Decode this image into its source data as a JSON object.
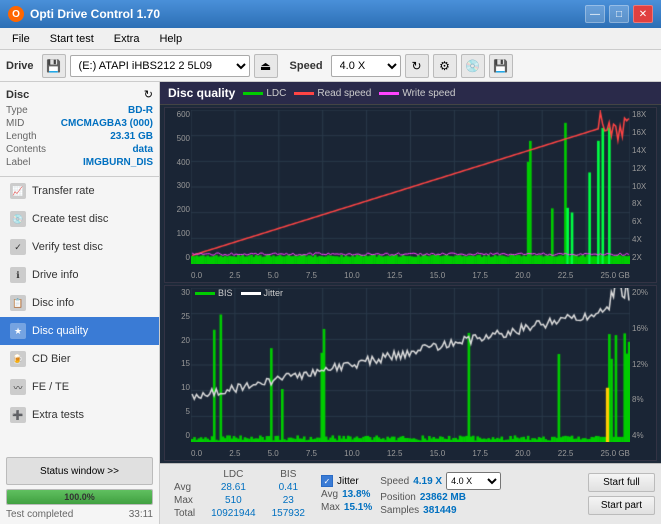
{
  "titleBar": {
    "title": "Opti Drive Control 1.70",
    "minimize": "—",
    "maximize": "□",
    "close": "✕"
  },
  "menuBar": {
    "items": [
      "File",
      "Start test",
      "Extra",
      "Help"
    ]
  },
  "toolbar": {
    "driveLabel": "Drive",
    "driveValue": "(E:) ATAPI iHBS212 2 5L09",
    "speedLabel": "Speed",
    "speedValue": "4.0 X"
  },
  "disc": {
    "sectionLabel": "Disc",
    "typeLabel": "Type",
    "typeValue": "BD-R",
    "midLabel": "MID",
    "midValue": "CMCMAGBA3 (000)",
    "lengthLabel": "Length",
    "lengthValue": "23.31 GB",
    "contentsLabel": "Contents",
    "contentsValue": "data",
    "labelLabel": "Label",
    "labelValue": "IMGBURN_DIS"
  },
  "nav": {
    "items": [
      {
        "id": "transfer-rate",
        "label": "Transfer rate",
        "icon": "📈"
      },
      {
        "id": "create-test-disc",
        "label": "Create test disc",
        "icon": "💿"
      },
      {
        "id": "verify-test-disc",
        "label": "Verify test disc",
        "icon": "✓"
      },
      {
        "id": "drive-info",
        "label": "Drive info",
        "icon": "ℹ"
      },
      {
        "id": "disc-info",
        "label": "Disc info",
        "icon": "📋"
      },
      {
        "id": "disc-quality",
        "label": "Disc quality",
        "icon": "★",
        "active": true
      },
      {
        "id": "cd-bier",
        "label": "CD Bier",
        "icon": "🍺"
      },
      {
        "id": "fe-te",
        "label": "FE / TE",
        "icon": "〰"
      },
      {
        "id": "extra-tests",
        "label": "Extra tests",
        "icon": "➕"
      }
    ]
  },
  "statusWindow": "Status window >>",
  "progress": {
    "percent": 100,
    "percentText": "100.0%"
  },
  "statusText": {
    "left": "Test completed",
    "right": "33:11"
  },
  "chartHeader": {
    "title": "Disc quality",
    "legend": [
      {
        "label": "LDC",
        "color": "#00cc00"
      },
      {
        "label": "Read speed",
        "color": "#ff0000"
      },
      {
        "label": "Write speed",
        "color": "#ff00ff"
      }
    ],
    "legend2": [
      {
        "label": "BIS",
        "color": "#00cc00"
      },
      {
        "label": "Jitter",
        "color": "#ffffff"
      }
    ]
  },
  "chart1": {
    "yLabels": [
      "0",
      "100",
      "200",
      "300",
      "400",
      "500",
      "600"
    ],
    "yLabelsRight": [
      "2X",
      "4X",
      "6X",
      "8X",
      "10X",
      "12X",
      "14X",
      "16X",
      "18X"
    ],
    "xLabels": [
      "0.0",
      "2.5",
      "5.0",
      "7.5",
      "10.0",
      "12.5",
      "15.0",
      "17.5",
      "20.0",
      "22.5",
      "25.0 GB"
    ]
  },
  "chart2": {
    "yLabels": [
      "0",
      "5",
      "10",
      "15",
      "20",
      "25",
      "30"
    ],
    "yLabelsRight": [
      "4%",
      "8%",
      "12%",
      "16%",
      "20%"
    ],
    "xLabels": [
      "0.0",
      "2.5",
      "5.0",
      "7.5",
      "10.0",
      "12.5",
      "15.0",
      "17.5",
      "20.0",
      "22.5",
      "25.0 GB"
    ]
  },
  "stats": {
    "headers": [
      "LDC",
      "BIS"
    ],
    "rows": [
      {
        "label": "Avg",
        "ldc": "28.61",
        "bis": "0.41"
      },
      {
        "label": "Max",
        "ldc": "510",
        "bis": "23"
      },
      {
        "label": "Total",
        "ldc": "10921944",
        "bis": "157932"
      }
    ],
    "jitter": {
      "checked": true,
      "label": "Jitter",
      "avgVal": "13.8%",
      "maxVal": "15.1%"
    },
    "speed": {
      "label": "Speed",
      "value": "4.19 X",
      "selectValue": "4.0 X"
    },
    "position": {
      "label": "Position",
      "value": "23862 MB"
    },
    "samples": {
      "label": "Samples",
      "value": "381449"
    },
    "buttons": {
      "startFull": "Start full",
      "startPart": "Start part"
    }
  }
}
